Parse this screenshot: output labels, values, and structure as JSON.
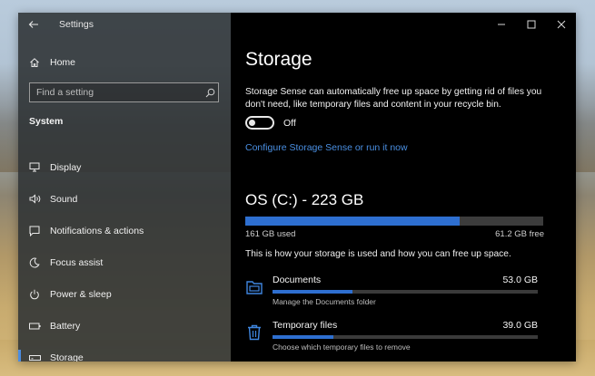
{
  "window": {
    "app_title": "Settings",
    "controls": {
      "minimize": "—",
      "maximize": "☐",
      "close": "✕"
    }
  },
  "sidebar": {
    "back_icon": "back-arrow-icon",
    "home_label": "Home",
    "home_icon": "home-icon",
    "search": {
      "placeholder": "Find a setting",
      "icon": "search-icon"
    },
    "section": "System",
    "items": [
      {
        "label": "Display",
        "icon": "monitor-icon",
        "active": false
      },
      {
        "label": "Sound",
        "icon": "speaker-icon",
        "active": false
      },
      {
        "label": "Notifications & actions",
        "icon": "message-icon",
        "active": false
      },
      {
        "label": "Focus assist",
        "icon": "moon-icon",
        "active": false
      },
      {
        "label": "Power & sleep",
        "icon": "power-icon",
        "active": false
      },
      {
        "label": "Battery",
        "icon": "battery-icon",
        "active": false
      },
      {
        "label": "Storage",
        "icon": "storage-drive-icon",
        "active": true
      }
    ]
  },
  "main": {
    "title": "Storage",
    "description": "Storage Sense can automatically free up space by getting rid of files you don't need, like temporary files and content in your recycle bin.",
    "storage_sense_toggle": {
      "state": "Off",
      "on": false
    },
    "configure_link": "Configure Storage Sense or run it now",
    "drive": {
      "title": "OS (C:) - 223 GB",
      "used_label": "161 GB used",
      "free_label": "61.2 GB free",
      "used_fraction": 0.72
    },
    "usage_description": "This is how your storage is used and how you can free up space.",
    "categories": [
      {
        "name": "Documents",
        "size": "53.0 GB",
        "subtitle": "Manage the Documents folder",
        "icon": "documents-folder-icon",
        "fraction": 0.3
      },
      {
        "name": "Temporary files",
        "size": "39.0 GB",
        "subtitle": "Choose which temporary files to remove",
        "icon": "trash-icon",
        "fraction": 0.23
      }
    ]
  },
  "colors": {
    "accent": "#2e6fd0",
    "link": "#4a8fe2",
    "sidebar_bg": "#2e3234",
    "main_bg": "#000000"
  }
}
